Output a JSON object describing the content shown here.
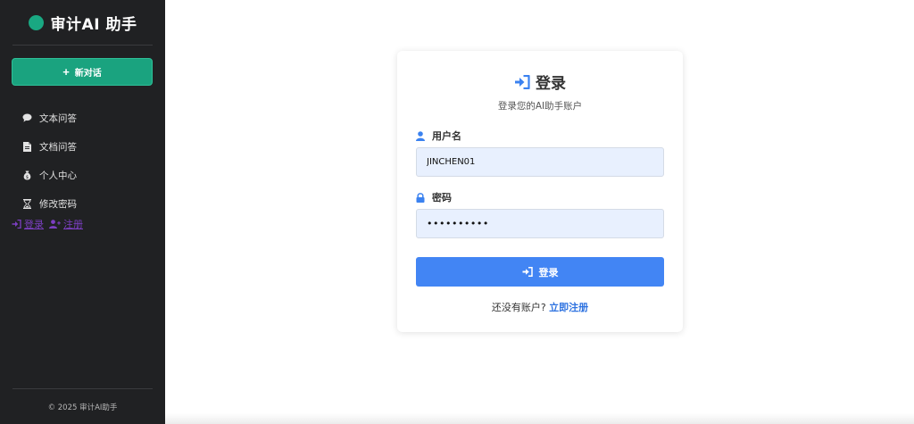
{
  "sidebar": {
    "brand_title": "审计AI 助手",
    "new_chat_label": "新对话",
    "items": [
      {
        "label": "文本问答",
        "icon": "chat-bubble-icon"
      },
      {
        "label": "文档问答",
        "icon": "document-icon"
      },
      {
        "label": "个人中心",
        "icon": "money-bag-icon"
      },
      {
        "label": "修改密码",
        "icon": "hourglass-icon"
      }
    ],
    "login_link": "登录",
    "register_link": "注册",
    "footer": "© 2025 审计AI助手"
  },
  "login": {
    "title": "登录",
    "subtitle": "登录您的AI助手账户",
    "username_label": "用户名",
    "username_value": "JINCHEN01",
    "password_label": "密码",
    "password_value": "••••••••••",
    "submit_label": "登录",
    "no_account_text": "还没有账户?",
    "register_now_link": "立即注册"
  },
  "colors": {
    "sidebar_bg": "#202123",
    "accent_green": "#1aa37f",
    "primary_blue": "#4285f4",
    "link_purple": "#7c3fc2"
  }
}
